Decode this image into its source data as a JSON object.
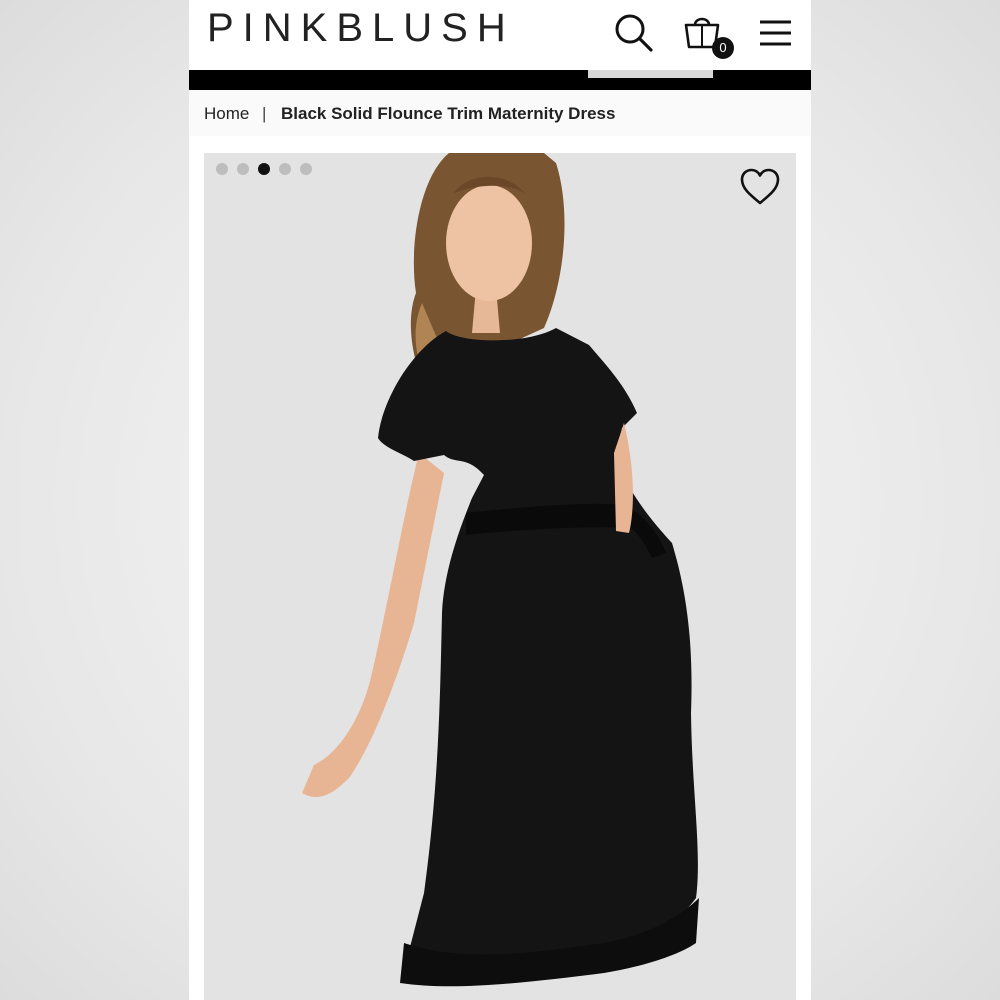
{
  "header": {
    "logo": "PINKBLUSH",
    "cart_count": "0",
    "icons": [
      "search-icon",
      "shopping-bag-icon",
      "hamburger-menu-icon"
    ]
  },
  "breadcrumb": {
    "home": "Home",
    "separator": "|",
    "current": "Black Solid Flounce Trim Maternity Dress"
  },
  "gallery": {
    "total_images": 5,
    "active_index": 3,
    "favorite_icon": "heart-outline-icon"
  },
  "colors": {
    "nav_bar": "#000000",
    "accent": "#111111",
    "image_background": "#e2e2e2"
  }
}
